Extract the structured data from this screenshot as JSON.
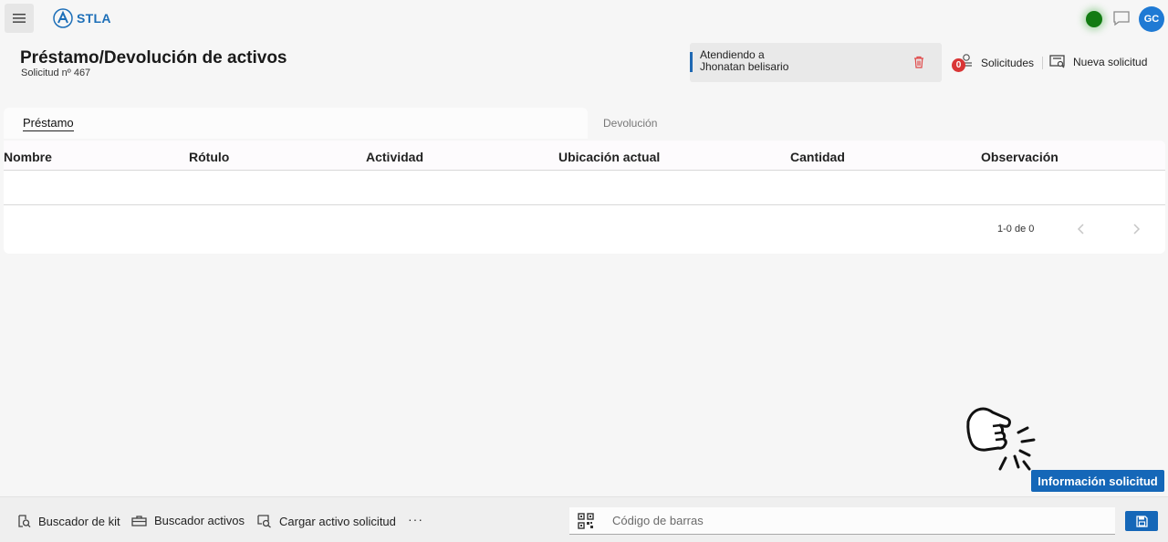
{
  "header": {
    "app_name": "STLA",
    "user_initials": "GC",
    "menu_icon": "menu-icon",
    "chat_icon": "chat-icon"
  },
  "page": {
    "title": "Préstamo/Devolución de activos",
    "subtitle": "Solicitud nº 467"
  },
  "attending": {
    "label": "Atendiendo a",
    "name": "Jhonatan belisario"
  },
  "actions": {
    "requests_label": "Solicitudes",
    "requests_count": "0",
    "new_request_label": "Nueva solicitud"
  },
  "tabs": [
    {
      "label": "Préstamo",
      "active": true
    },
    {
      "label": "Devolución",
      "active": false
    }
  ],
  "table": {
    "columns": [
      "Nombre",
      "Rótulo",
      "Actividad",
      "Ubicación actual",
      "Cantidad",
      "Observación"
    ],
    "rows": [],
    "pagination": "1-0 de 0"
  },
  "floating": {
    "info_button": "Información solicitud"
  },
  "toolbar": {
    "kit_finder": "Buscador de kit",
    "asset_finder": "Buscador activos",
    "load_asset": "Cargar activo solicitud",
    "more": "···",
    "barcode_placeholder": "Código de barras"
  },
  "colors": {
    "primary": "#1567b8",
    "status_online": "#127b12",
    "badge": "#d93535",
    "avatar": "#1f7ad4"
  }
}
